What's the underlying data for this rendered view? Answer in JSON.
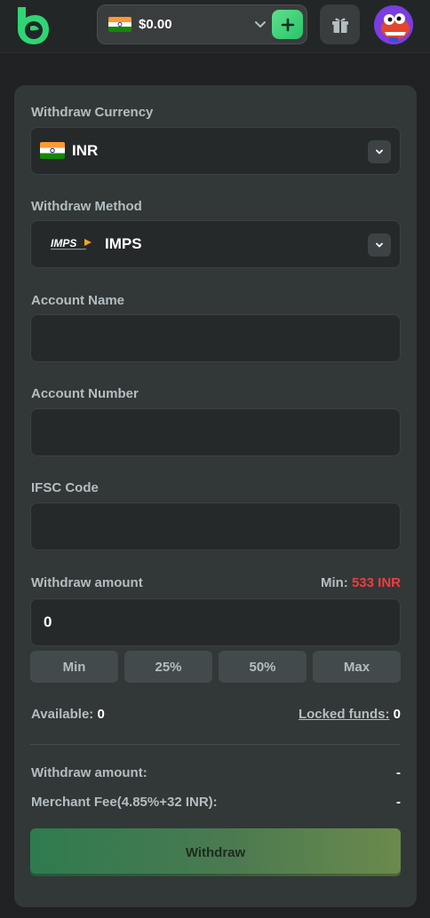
{
  "header": {
    "balance": "$0.00",
    "colors": {
      "accent": "#27c46b",
      "header_bg": "#232626"
    }
  },
  "form": {
    "currency": {
      "label": "Withdraw Currency",
      "value": "INR"
    },
    "method": {
      "label": "Withdraw Method",
      "value": "IMPS",
      "logo_text": "IMPS"
    },
    "account_name": {
      "label": "Account Name",
      "value": ""
    },
    "account_number": {
      "label": "Account Number",
      "value": ""
    },
    "ifsc": {
      "label": "IFSC Code",
      "value": ""
    },
    "amount": {
      "label": "Withdraw amount",
      "min_label": "Min:",
      "min_value": "533 INR",
      "value": "0"
    },
    "quick_buttons": [
      "Min",
      "25%",
      "50%",
      "Max"
    ],
    "available_label": "Available:",
    "available_value": "0",
    "locked_label": "Locked funds:",
    "locked_value": "0",
    "summary": {
      "withdraw_amount_label": "Withdraw amount:",
      "withdraw_amount_value": "-",
      "fee_label": "Merchant Fee(4.85%+32 INR):",
      "fee_value": "-"
    },
    "submit_label": "Withdraw"
  },
  "icons": {
    "logo": "bc-logo-icon",
    "flag": "india-flag-icon",
    "chevron": "chevron-down-icon",
    "deposit": "plus-icon",
    "gift": "gift-icon",
    "avatar": "avatar"
  },
  "colors": {
    "min_value": "#ee3d3d",
    "label": "#b3bec1",
    "card_bg": "#323738",
    "input_bg": "#26292a"
  }
}
